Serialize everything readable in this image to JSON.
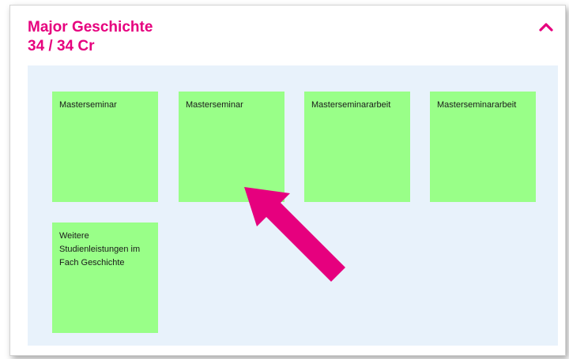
{
  "section": {
    "title": "Major Geschichte",
    "credits": "34 / 34 Cr",
    "collapse_icon": "chevron-up-icon",
    "accent_color": "#e6007e"
  },
  "modules": [
    {
      "label": "Masterseminar"
    },
    {
      "label": "Masterseminar"
    },
    {
      "label": "Masterseminararbeit"
    },
    {
      "label": "Masterseminararbeit"
    },
    {
      "label": "Weitere Studienleistungen im Fach Geschichte"
    }
  ],
  "colors": {
    "panel_bg": "#e8f2fb",
    "tile_bg": "#99ff88",
    "annotation_arrow": "#e6007e"
  },
  "annotation": {
    "icon": "pointer-arrow-icon"
  }
}
